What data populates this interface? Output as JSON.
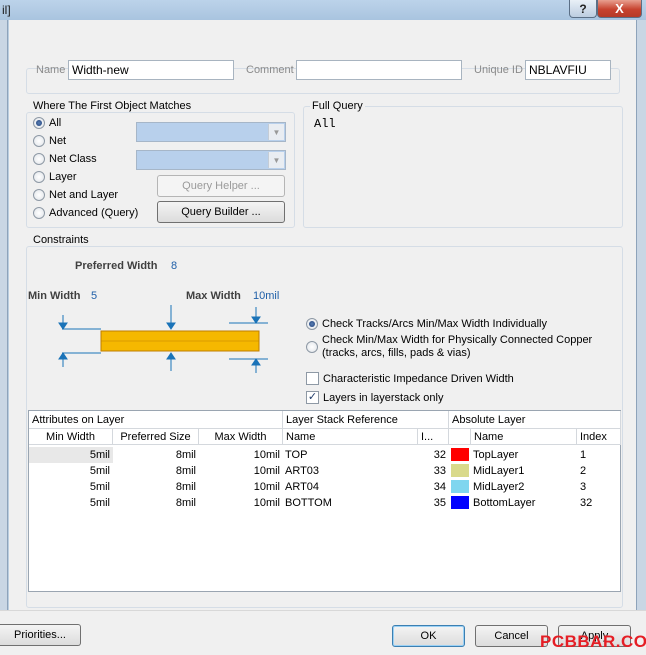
{
  "window": {
    "title_fragment": "il]",
    "help_label": "?",
    "close_label": "X"
  },
  "top_fields": {
    "name_label": "Name",
    "name_value": "Width-new",
    "comment_label": "Comment",
    "comment_value": "",
    "unique_id_label": "Unique ID",
    "unique_id_value": "NBLAVFIU"
  },
  "match": {
    "title": "Where The First Object Matches",
    "options": [
      "All",
      "Net",
      "Net Class",
      "Layer",
      "Net and Layer",
      "Advanced (Query)"
    ],
    "selected": "All",
    "query_helper_label": "Query Helper ...",
    "query_builder_label": "Query Builder ..."
  },
  "full_query": {
    "title": "Full Query",
    "text": "All"
  },
  "constraints": {
    "title": "Constraints",
    "preferred_width_label": "Preferred Width",
    "preferred_width_value": "8",
    "min_width_label": "Min Width",
    "min_width_value": "5",
    "max_width_label": "Max Width",
    "max_width_value": "10mil",
    "option_individual": "Check Tracks/Arcs Min/Max Width Individually",
    "option_connected_line1": "Check Min/Max Width for Physically Connected Copper",
    "option_connected_line2": "(tracks, arcs, fills, pads & vias)",
    "impedance_label": "Characteristic Impedance Driven Width",
    "impedance_checked": false,
    "layerstack_label": "Layers in layerstack only",
    "layerstack_checked": true,
    "colors": {
      "track": "#f5b800",
      "track_edge": "#c07e00",
      "arrows": "#1a73b8"
    }
  },
  "table": {
    "group_headers": [
      "Attributes on Layer",
      "Layer Stack Reference",
      "Absolute Layer"
    ],
    "columns": [
      "Min Width",
      "Preferred Size",
      "Max Width",
      "Name",
      "I...",
      "Name",
      "Index"
    ],
    "rows": [
      {
        "min": "5mil",
        "pref": "8mil",
        "max": "10mil",
        "ref_name": "TOP",
        "ref_index": "32",
        "color": "#ff0000",
        "layer": "TopLayer",
        "index": "1"
      },
      {
        "min": "5mil",
        "pref": "8mil",
        "max": "10mil",
        "ref_name": "ART03",
        "ref_index": "33",
        "color": "#d9d98a",
        "layer": "MidLayer1",
        "index": "2"
      },
      {
        "min": "5mil",
        "pref": "8mil",
        "max": "10mil",
        "ref_name": "ART04",
        "ref_index": "34",
        "color": "#7fd6ef",
        "layer": "MidLayer2",
        "index": "3"
      },
      {
        "min": "5mil",
        "pref": "8mil",
        "max": "10mil",
        "ref_name": "BOTTOM",
        "ref_index": "35",
        "color": "#0000ff",
        "layer": "BottomLayer",
        "index": "32"
      }
    ]
  },
  "footer": {
    "priorities_label": "Priorities...",
    "ok_label": "OK",
    "cancel_label": "Cancel",
    "apply_label": "Apply",
    "watermark": "PCBBAR.COM"
  }
}
